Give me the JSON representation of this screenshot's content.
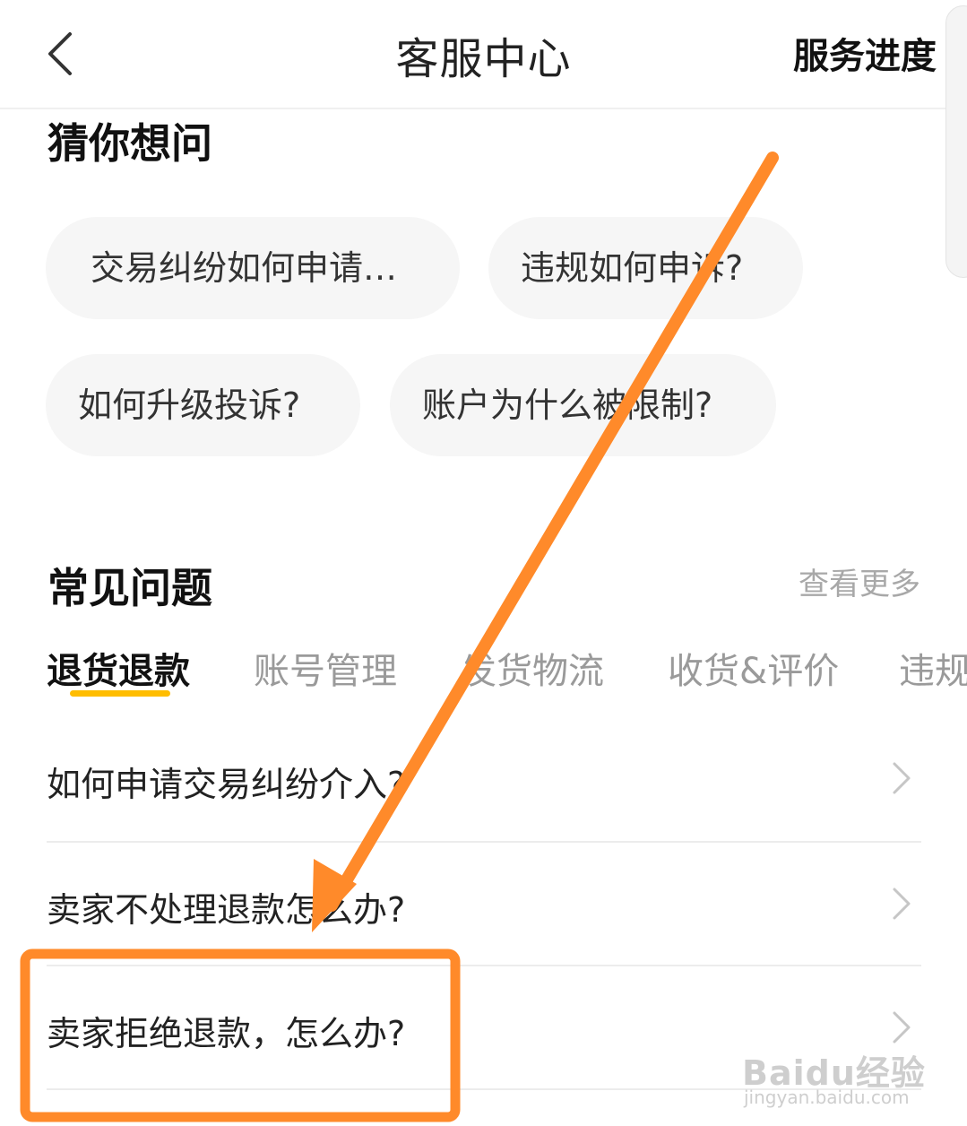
{
  "header": {
    "title": "客服中心",
    "progress_label": "服务进度"
  },
  "guess": {
    "title": "猜你想问",
    "chips": [
      {
        "label": "交易纠纷如何申请…"
      },
      {
        "label": "违规如何申诉?"
      },
      {
        "label": "如何升级投诉?"
      },
      {
        "label": "账户为什么被限制?"
      }
    ]
  },
  "faq": {
    "title": "常见问题",
    "more_label": "查看更多",
    "tabs": [
      {
        "label": "退货退款",
        "active": true
      },
      {
        "label": "账号管理",
        "active": false
      },
      {
        "label": "发货物流",
        "active": false
      },
      {
        "label": "收货&评价",
        "active": false
      },
      {
        "label": "违规",
        "active": false
      }
    ],
    "items": [
      {
        "label": "如何申请交易纠纷介入?"
      },
      {
        "label": "卖家不处理退款怎么办?"
      },
      {
        "label": "卖家拒绝退款，怎么办?"
      }
    ]
  },
  "annotation": {
    "color": "#ff8a2a"
  },
  "watermark": {
    "logo_text": "Baidu经验",
    "url_text": "jingyan.baidu.com"
  },
  "colors": {
    "accent": "#ffbd00",
    "annotation": "#ff8a2a",
    "chip_bg": "#f6f6f6"
  }
}
